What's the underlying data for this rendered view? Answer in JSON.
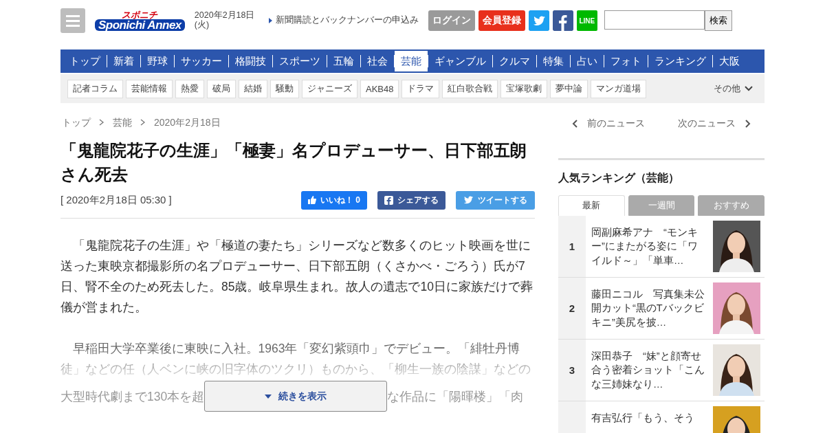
{
  "header": {
    "logo_top": "スポニチ",
    "logo_main": "Sponichi Annex",
    "date": "2020年2月18日(火)",
    "subscribe_link": "新聞購読とバックナンバーの申込み",
    "login": "ログイン",
    "register": "会員登録",
    "line": "LINE",
    "search_button": "検索"
  },
  "nav": [
    {
      "label": "トップ",
      "selected": false
    },
    {
      "label": "新着",
      "selected": false
    },
    {
      "label": "野球",
      "selected": false
    },
    {
      "label": "サッカー",
      "selected": false
    },
    {
      "label": "格闘技",
      "selected": false
    },
    {
      "label": "スポーツ",
      "selected": false
    },
    {
      "label": "五輪",
      "selected": false
    },
    {
      "label": "社会",
      "selected": false
    },
    {
      "label": "芸能",
      "selected": true
    },
    {
      "label": "ギャンブル",
      "selected": false
    },
    {
      "label": "クルマ",
      "selected": false
    },
    {
      "label": "特集",
      "selected": false
    },
    {
      "label": "占い",
      "selected": false
    },
    {
      "label": "フォト",
      "selected": false
    },
    {
      "label": "ランキング",
      "selected": false
    },
    {
      "label": "大阪",
      "selected": false
    }
  ],
  "subnav": {
    "items": [
      "記者コラム",
      "芸能情報",
      "熱愛",
      "破局",
      "結婚",
      "騒動",
      "ジャニーズ",
      "AKB48",
      "ドラマ",
      "紅白歌合戦",
      "宝塚歌劇",
      "夢中論",
      "マンガ道場"
    ],
    "more": "その他"
  },
  "breadcrumb": [
    "トップ",
    "芸能",
    "2020年2月18日"
  ],
  "article": {
    "title": "「鬼龍院花子の生涯」「極妻」名プロデューサー、日下部五朗さん死去",
    "timestamp": "[ 2020年2月18日 05:30 ]",
    "like": "いいね！ 0",
    "share": "シェアする",
    "tweet": "ツイートする",
    "paragraphs": [
      "「鬼龍院花子の生涯」や「極道の妻たち」シリーズなど数多くのヒット映画を世に送った東映京都撮影所の名プロデューサー、日下部五朗（くさかべ・ごろう）氏が7日、腎不全のため死去した。85歳。岐阜県生まれ。故人の遺志で10日に家族だけで葬儀が営まれた。",
      "早稲田大学卒業後に東映に入社。1963年「変幻紫頭巾」でデビュー。「緋牡丹博徒」などの任（人ベンに峡の旧字体のツクリ）ものから、「柳生一族の陰謀」などの"
    ],
    "covered_left": "大型時代劇まで130本を超",
    "covered_right": "な作品に「陽暉楼」「肉",
    "more_button": "続きを表示"
  },
  "sidebar": {
    "prev": "前のニュース",
    "next": "次のニュース",
    "ranking_title": "人気ランキング（芸能）",
    "tabs": [
      {
        "label": "最新",
        "selected": true
      },
      {
        "label": "一週間",
        "selected": false
      },
      {
        "label": "おすすめ",
        "selected": false
      }
    ],
    "ranking": [
      {
        "rank": "1",
        "title": "岡副麻希アナ　“モンキー”にまたがる姿に「ワイルド～」「単車…"
      },
      {
        "rank": "2",
        "title": "藤田ニコル　写真集未公開カット“黒のTバックビキニ”美尻を披…"
      },
      {
        "rank": "3",
        "title": "深田恭子　“妹”と顔寄せ合う密着ショット「こんな三姉妹なり…"
      },
      {
        "title": "有吉弘行「もう、そう"
      }
    ]
  }
}
